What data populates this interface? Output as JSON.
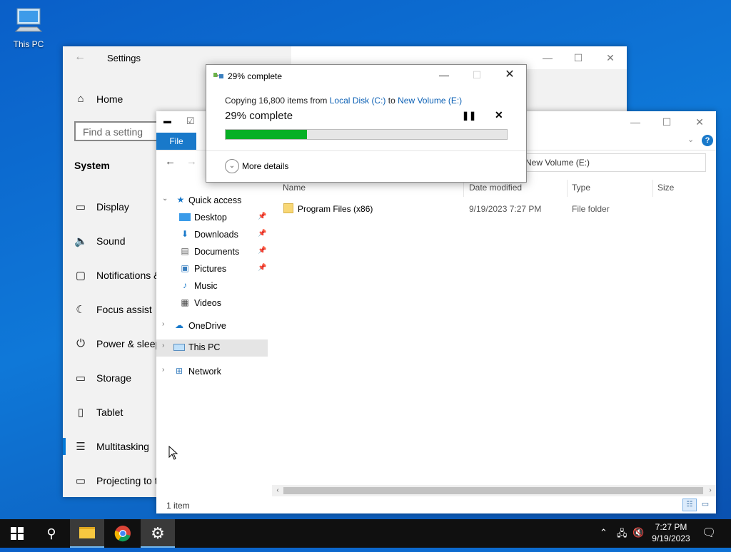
{
  "desktop": {
    "this_pc_label": "This PC"
  },
  "settings": {
    "title": "Settings",
    "home": "Home",
    "search_placeholder": "Find a setting",
    "section": "System",
    "nav": [
      "Display",
      "Sound",
      "Notifications &",
      "Focus assist",
      "Power & sleep",
      "Storage",
      "Tablet",
      "Multitasking",
      "Projecting to th"
    ]
  },
  "explorer": {
    "file_tab": "File",
    "address": "New Volume (E:)",
    "quick_access": "Quick access",
    "quick_items": [
      "Desktop",
      "Downloads",
      "Documents",
      "Pictures",
      "Music",
      "Videos"
    ],
    "onedrive": "OneDrive",
    "this_pc": "This PC",
    "network": "Network",
    "columns": {
      "name": "Name",
      "date": "Date modified",
      "type": "Type",
      "size": "Size"
    },
    "rows": [
      {
        "name": "Program Files (x86)",
        "date": "9/19/2023 7:27 PM",
        "type": "File folder"
      }
    ],
    "status": "1 item"
  },
  "copy_dialog": {
    "title": "29% complete",
    "desc_prefix": "Copying 16,800 items from ",
    "source": "Local Disk (C:)",
    "desc_mid": " to ",
    "dest": "New Volume (E:)",
    "heading": "29% complete",
    "progress_percent": 29,
    "more_details": "More details"
  },
  "taskbar": {
    "time": "7:27 PM",
    "date": "9/19/2023"
  },
  "colors": {
    "accent": "#0078d7",
    "progress": "#06b025",
    "link": "#0a5fb4"
  }
}
